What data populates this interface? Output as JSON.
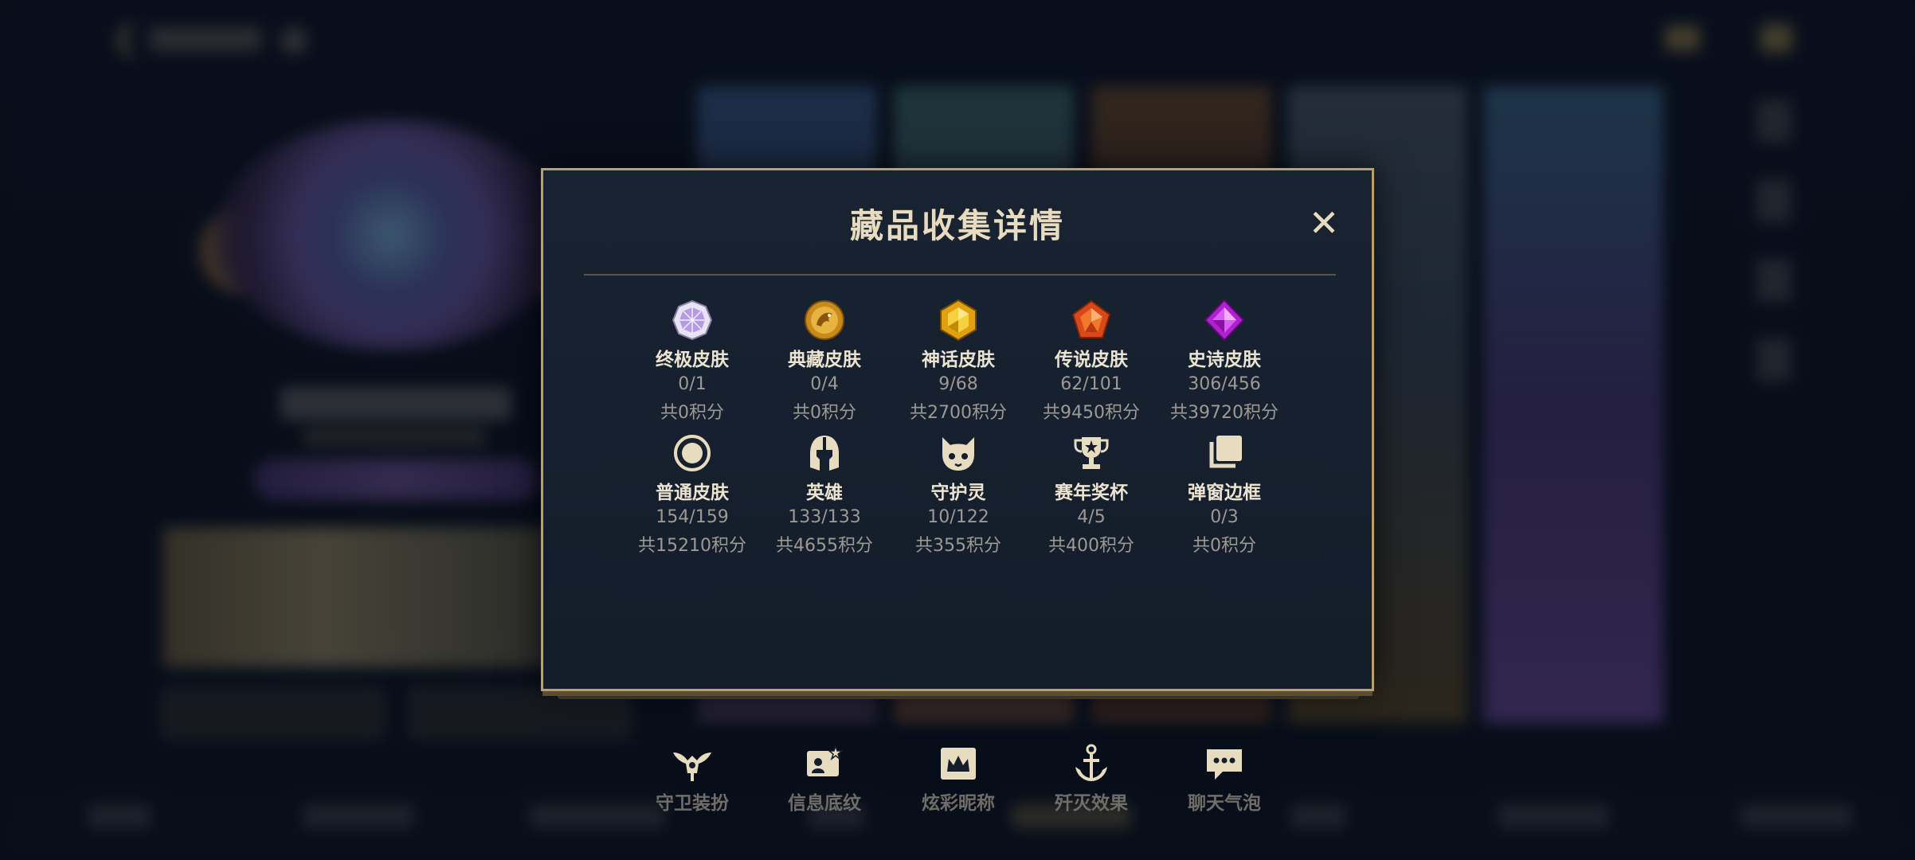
{
  "modal": {
    "title": "藏品收集详情",
    "close_icon": "close-icon"
  },
  "items": [
    {
      "label": "终极皮肤",
      "count": "0/1",
      "points": "共0积分",
      "icon": "ultimate-skin-icon"
    },
    {
      "label": "典藏皮肤",
      "count": "0/4",
      "points": "共0积分",
      "icon": "collection-skin-icon"
    },
    {
      "label": "神话皮肤",
      "count": "9/68",
      "points": "共2700积分",
      "icon": "mythic-skin-icon"
    },
    {
      "label": "传说皮肤",
      "count": "62/101",
      "points": "共9450积分",
      "icon": "legendary-skin-icon"
    },
    {
      "label": "史诗皮肤",
      "count": "306/456",
      "points": "共39720积分",
      "icon": "epic-skin-icon"
    },
    {
      "label": "普通皮肤",
      "count": "154/159",
      "points": "共15210积分",
      "icon": "common-skin-icon"
    },
    {
      "label": "英雄",
      "count": "133/133",
      "points": "共4655积分",
      "icon": "hero-helmet-icon"
    },
    {
      "label": "守护灵",
      "count": "10/122",
      "points": "共355积分",
      "icon": "guardian-spirit-icon"
    },
    {
      "label": "赛年奖杯",
      "count": "4/5",
      "points": "共400积分",
      "icon": "trophy-icon"
    },
    {
      "label": "弹窗边框",
      "count": "0/3",
      "points": "共0积分",
      "icon": "popup-frame-icon"
    },
    {
      "label": "守卫装扮",
      "icon": "ward-skin-icon"
    },
    {
      "label": "信息底纹",
      "icon": "info-card-icon"
    },
    {
      "label": "炫彩昵称",
      "icon": "colorful-name-icon"
    },
    {
      "label": "歼灭效果",
      "icon": "elimination-effect-icon"
    },
    {
      "label": "聊天气泡",
      "icon": "chat-bubble-icon"
    }
  ],
  "colors": {
    "modal_border": "#b9a06a",
    "title": "#e8dcc0",
    "label": "#ece4d0",
    "muted": "#9c9a92"
  }
}
